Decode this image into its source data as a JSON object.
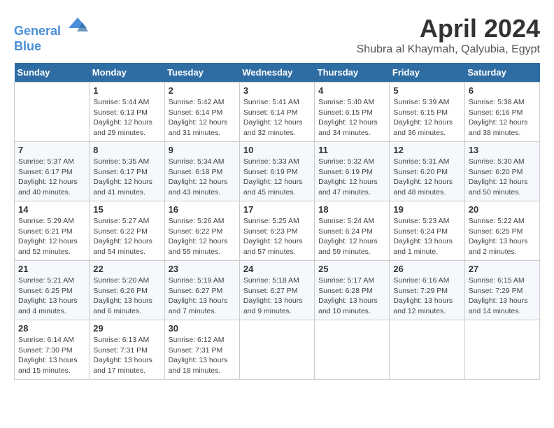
{
  "header": {
    "logo_line1": "General",
    "logo_line2": "Blue",
    "month_title": "April 2024",
    "subtitle": "Shubra al Khaymah, Qalyubia, Egypt"
  },
  "days_of_week": [
    "Sunday",
    "Monday",
    "Tuesday",
    "Wednesday",
    "Thursday",
    "Friday",
    "Saturday"
  ],
  "weeks": [
    [
      {
        "num": "",
        "detail": ""
      },
      {
        "num": "1",
        "detail": "Sunrise: 5:44 AM\nSunset: 6:13 PM\nDaylight: 12 hours\nand 29 minutes."
      },
      {
        "num": "2",
        "detail": "Sunrise: 5:42 AM\nSunset: 6:14 PM\nDaylight: 12 hours\nand 31 minutes."
      },
      {
        "num": "3",
        "detail": "Sunrise: 5:41 AM\nSunset: 6:14 PM\nDaylight: 12 hours\nand 32 minutes."
      },
      {
        "num": "4",
        "detail": "Sunrise: 5:40 AM\nSunset: 6:15 PM\nDaylight: 12 hours\nand 34 minutes."
      },
      {
        "num": "5",
        "detail": "Sunrise: 5:39 AM\nSunset: 6:15 PM\nDaylight: 12 hours\nand 36 minutes."
      },
      {
        "num": "6",
        "detail": "Sunrise: 5:38 AM\nSunset: 6:16 PM\nDaylight: 12 hours\nand 38 minutes."
      }
    ],
    [
      {
        "num": "7",
        "detail": "Sunrise: 5:37 AM\nSunset: 6:17 PM\nDaylight: 12 hours\nand 40 minutes."
      },
      {
        "num": "8",
        "detail": "Sunrise: 5:35 AM\nSunset: 6:17 PM\nDaylight: 12 hours\nand 41 minutes."
      },
      {
        "num": "9",
        "detail": "Sunrise: 5:34 AM\nSunset: 6:18 PM\nDaylight: 12 hours\nand 43 minutes."
      },
      {
        "num": "10",
        "detail": "Sunrise: 5:33 AM\nSunset: 6:19 PM\nDaylight: 12 hours\nand 45 minutes."
      },
      {
        "num": "11",
        "detail": "Sunrise: 5:32 AM\nSunset: 6:19 PM\nDaylight: 12 hours\nand 47 minutes."
      },
      {
        "num": "12",
        "detail": "Sunrise: 5:31 AM\nSunset: 6:20 PM\nDaylight: 12 hours\nand 48 minutes."
      },
      {
        "num": "13",
        "detail": "Sunrise: 5:30 AM\nSunset: 6:20 PM\nDaylight: 12 hours\nand 50 minutes."
      }
    ],
    [
      {
        "num": "14",
        "detail": "Sunrise: 5:29 AM\nSunset: 6:21 PM\nDaylight: 12 hours\nand 52 minutes."
      },
      {
        "num": "15",
        "detail": "Sunrise: 5:27 AM\nSunset: 6:22 PM\nDaylight: 12 hours\nand 54 minutes."
      },
      {
        "num": "16",
        "detail": "Sunrise: 5:26 AM\nSunset: 6:22 PM\nDaylight: 12 hours\nand 55 minutes."
      },
      {
        "num": "17",
        "detail": "Sunrise: 5:25 AM\nSunset: 6:23 PM\nDaylight: 12 hours\nand 57 minutes."
      },
      {
        "num": "18",
        "detail": "Sunrise: 5:24 AM\nSunset: 6:24 PM\nDaylight: 12 hours\nand 59 minutes."
      },
      {
        "num": "19",
        "detail": "Sunrise: 5:23 AM\nSunset: 6:24 PM\nDaylight: 13 hours\nand 1 minute."
      },
      {
        "num": "20",
        "detail": "Sunrise: 5:22 AM\nSunset: 6:25 PM\nDaylight: 13 hours\nand 2 minutes."
      }
    ],
    [
      {
        "num": "21",
        "detail": "Sunrise: 5:21 AM\nSunset: 6:25 PM\nDaylight: 13 hours\nand 4 minutes."
      },
      {
        "num": "22",
        "detail": "Sunrise: 5:20 AM\nSunset: 6:26 PM\nDaylight: 13 hours\nand 6 minutes."
      },
      {
        "num": "23",
        "detail": "Sunrise: 5:19 AM\nSunset: 6:27 PM\nDaylight: 13 hours\nand 7 minutes."
      },
      {
        "num": "24",
        "detail": "Sunrise: 5:18 AM\nSunset: 6:27 PM\nDaylight: 13 hours\nand 9 minutes."
      },
      {
        "num": "25",
        "detail": "Sunrise: 5:17 AM\nSunset: 6:28 PM\nDaylight: 13 hours\nand 10 minutes."
      },
      {
        "num": "26",
        "detail": "Sunrise: 6:16 AM\nSunset: 7:29 PM\nDaylight: 13 hours\nand 12 minutes."
      },
      {
        "num": "27",
        "detail": "Sunrise: 6:15 AM\nSunset: 7:29 PM\nDaylight: 13 hours\nand 14 minutes."
      }
    ],
    [
      {
        "num": "28",
        "detail": "Sunrise: 6:14 AM\nSunset: 7:30 PM\nDaylight: 13 hours\nand 15 minutes."
      },
      {
        "num": "29",
        "detail": "Sunrise: 6:13 AM\nSunset: 7:31 PM\nDaylight: 13 hours\nand 17 minutes."
      },
      {
        "num": "30",
        "detail": "Sunrise: 6:12 AM\nSunset: 7:31 PM\nDaylight: 13 hours\nand 18 minutes."
      },
      {
        "num": "",
        "detail": ""
      },
      {
        "num": "",
        "detail": ""
      },
      {
        "num": "",
        "detail": ""
      },
      {
        "num": "",
        "detail": ""
      }
    ]
  ]
}
